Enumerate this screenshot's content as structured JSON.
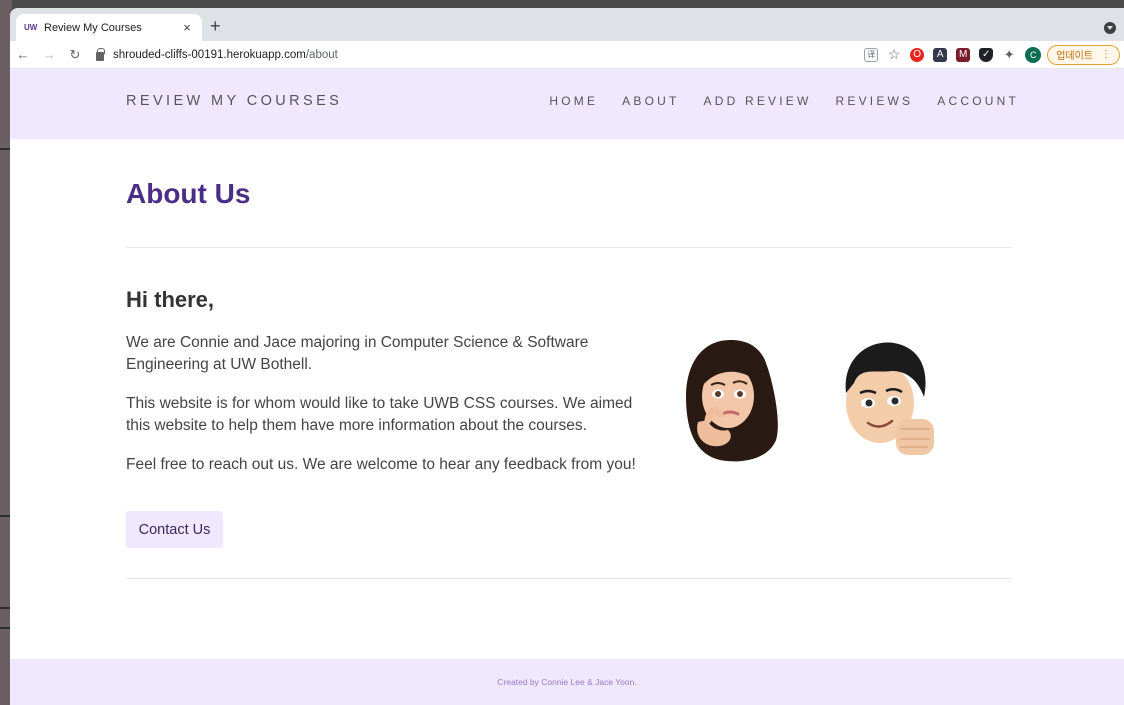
{
  "browser": {
    "tab": {
      "favicon": "UW",
      "title": "Review My Courses",
      "close": "×"
    },
    "new_tab": "+",
    "url": {
      "host": "shrouded-cliffs-00191.herokuapp.com",
      "path": "/about"
    },
    "update_label": "업데이트",
    "profile_initial": "C"
  },
  "site": {
    "brand": "REVIEW MY COURSES",
    "nav": [
      "HOME",
      "ABOUT",
      "ADD REVIEW",
      "REVIEWS",
      "ACCOUNT"
    ],
    "page_title": "About Us",
    "intro_heading": "Hi there,",
    "paragraphs": [
      "We are Connie and Jace majoring in Computer Science & Software Engineering at UW Bothell.",
      "This website is for whom would like to take UWB CSS courses. We aimed this website to help them have more information about the courses.",
      "Feel free to reach out us. We are welcome to hear any feedback from you!"
    ],
    "contact_button": "Contact Us",
    "footer": "Created by Connie Lee & Jace Yoon."
  },
  "colors": {
    "accent_bg": "#efe8ff",
    "title_purple": "#4a2e85",
    "footer_text": "#9a7cc9"
  }
}
